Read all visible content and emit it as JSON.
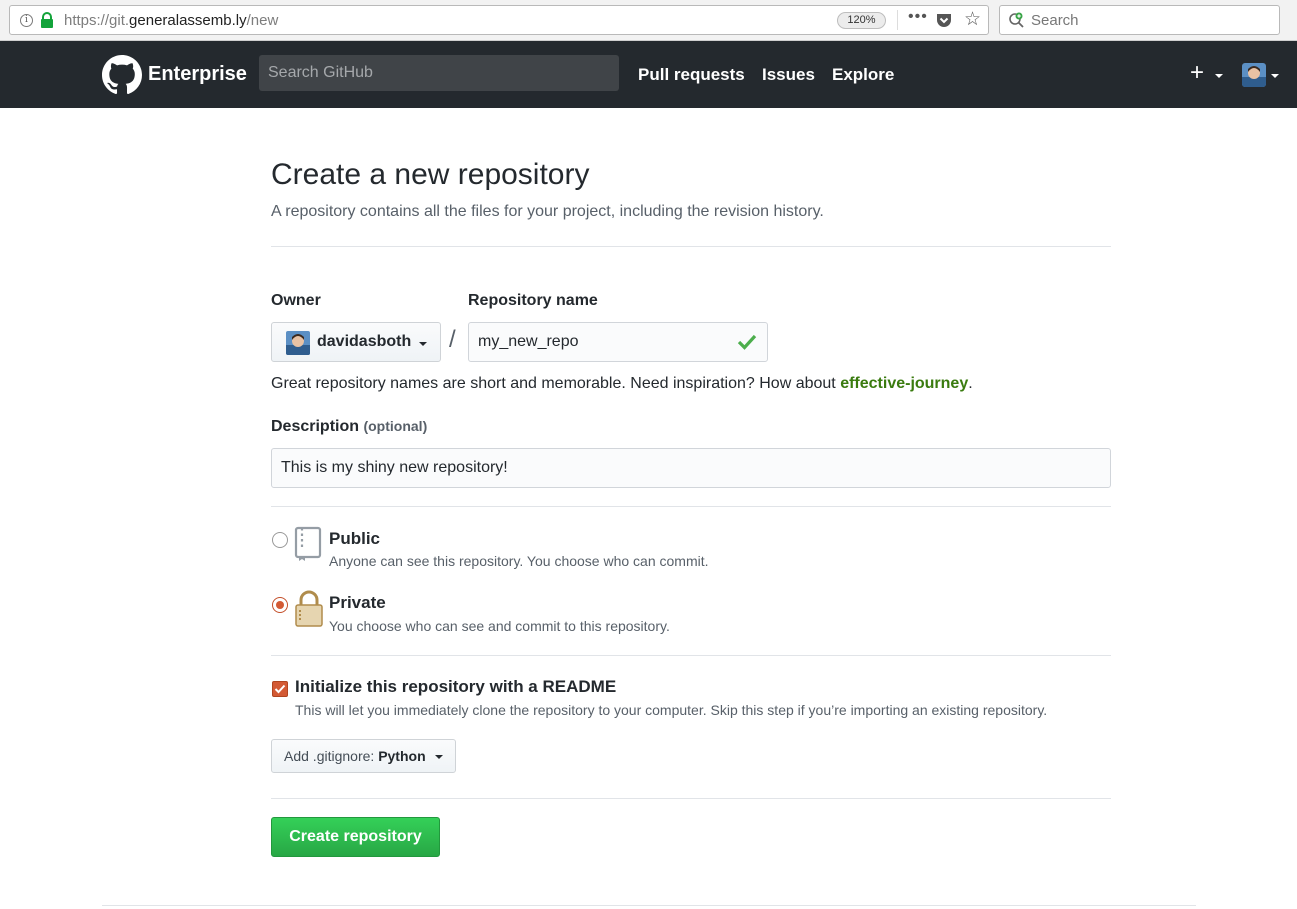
{
  "browser": {
    "url_prefix": "https://git.",
    "url_host": "generalassemb.ly",
    "url_path": "/new",
    "zoom": "120%",
    "more_label": "•••",
    "search_placeholder": "Search"
  },
  "header": {
    "brand": "Enterprise",
    "search_placeholder": "Search GitHub",
    "nav": [
      "Pull requests",
      "Issues",
      "Explore"
    ],
    "plus_label": "+"
  },
  "page": {
    "title": "Create a new repository",
    "subtitle": "A repository contains all the files for your project, including the revision history."
  },
  "form": {
    "owner_label": "Owner",
    "owner_value": "davidasboth",
    "slash": "/",
    "repo_label": "Repository name",
    "repo_value": "my_new_repo",
    "helper_prefix": "Great repository names are short and memorable. Need inspiration? How about ",
    "helper_suggestion": "effective-journey",
    "helper_suffix": ".",
    "description_label": "Description",
    "description_optional": "(optional)",
    "description_value": "This is my shiny new repository!",
    "visibility": [
      {
        "title": "Public",
        "desc": "Anyone can see this repository. You choose who can commit.",
        "checked": false
      },
      {
        "title": "Private",
        "desc": "You choose who can see and commit to this repository.",
        "checked": true
      }
    ],
    "readme_label": "Initialize this repository with a README",
    "readme_desc": "This will let you immediately clone the repository to your computer. Skip this step if you’re importing an existing repository.",
    "readme_checked": true,
    "gitignore_prefix": "Add .gitignore:",
    "gitignore_value": "Python",
    "submit_label": "Create repository"
  },
  "colors": {
    "header_bg": "#24292e",
    "accent_orange": "#d35a34",
    "success_green": "#28a745",
    "suggestion_green": "#3a7b0f"
  }
}
